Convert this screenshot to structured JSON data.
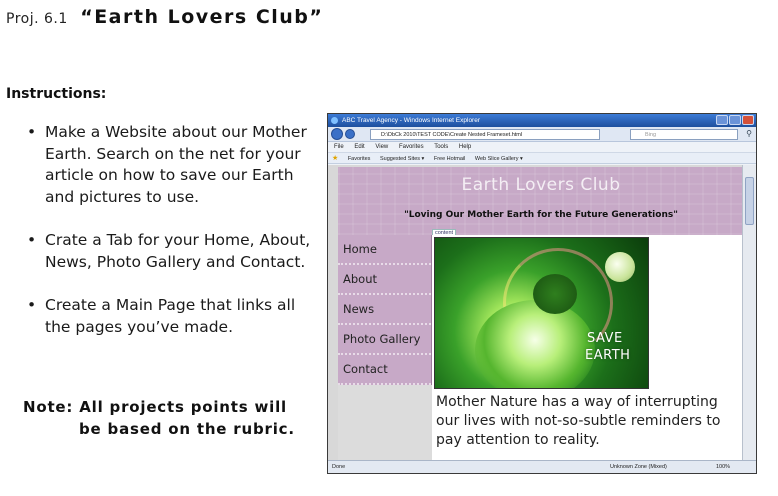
{
  "heading": {
    "proj": "Proj. 6.1",
    "title": "“Earth Lovers Club”"
  },
  "instructions": {
    "title": "Instructions:",
    "bullet_symbol": "•",
    "items": [
      "Make a Website about our Mother Earth. Search on the net for your article on    how to save our Earth and pictures to use.",
      "Crate a Tab for your Home, About, News, Photo Gallery and Contact.",
      "Create a Main Page that links all the pages you’ve made."
    ]
  },
  "note": {
    "line1": "Note: All projects points will",
    "line2": "be based on the rubric."
  },
  "browser": {
    "window_title": "ABC Travel Agency - Windows Internet Explorer",
    "address": "D:\\DbCk 2010\\TEST CODE\\Create Nested Frameset.html",
    "search_placeholder": "Bing",
    "menu": [
      "File",
      "Edit",
      "View",
      "Favorites",
      "Tools",
      "Help"
    ],
    "favorites": [
      "Favorites",
      "Suggested Sites ▾",
      "Free Hotmail",
      "Web Slice Gallery ▾"
    ],
    "status_left": "Done",
    "status_zone": "Unknown Zone (Mixed)",
    "status_zoom": "100%"
  },
  "site": {
    "title": "Earth Lovers Club",
    "slogan": "\"Loving Our Mother Earth for the Future Generations\"",
    "content_tag": "content",
    "nav": [
      "Home",
      "About",
      "News",
      "Photo Gallery",
      "Contact"
    ],
    "image_text_line1": "SAVE",
    "image_text_line2": "EARTH",
    "quote": "Mother Nature has a way of interrupting our lives with not-so-subtle reminders to pay attention to reality."
  },
  "colors": {
    "site_purple": "#c7a9c7",
    "ie_titlebar": "#1d4f9e"
  }
}
